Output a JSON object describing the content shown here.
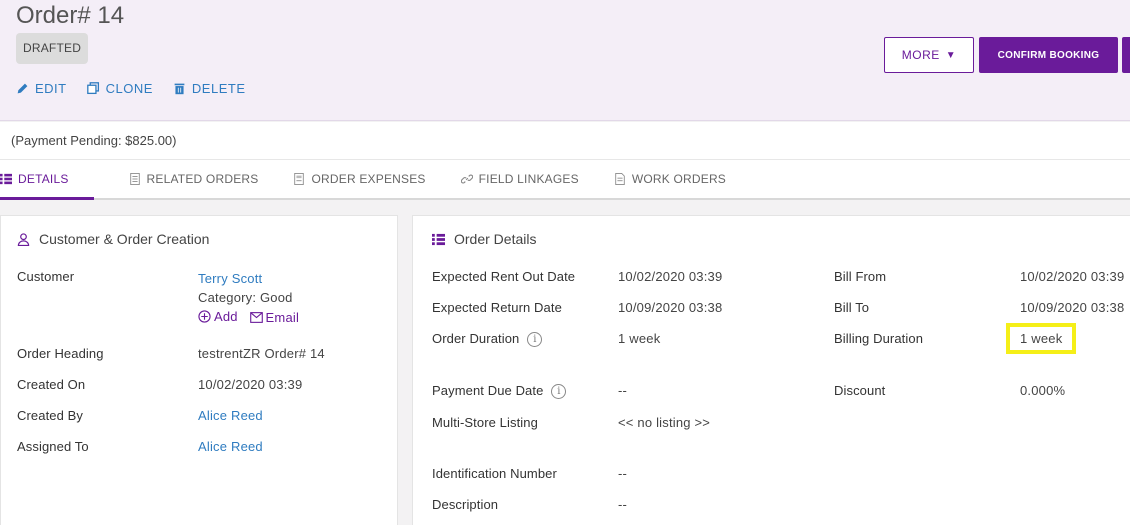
{
  "header": {
    "title": "Order# 14",
    "status": "DRAFTED",
    "actions": {
      "edit": "EDIT",
      "clone": "CLONE",
      "delete": "DELETE"
    },
    "more_label": "MORE",
    "confirm_label": "CONFIRM BOOKING"
  },
  "payment_pending": "(Payment Pending: $825.00)",
  "tabs": [
    {
      "label": "DETAILS",
      "icon": "list-icon"
    },
    {
      "label": "RELATED ORDERS",
      "icon": "document-icon"
    },
    {
      "label": "ORDER EXPENSES",
      "icon": "expense-icon"
    },
    {
      "label": "FIELD LINKAGES",
      "icon": "link-icon"
    },
    {
      "label": "WORK ORDERS",
      "icon": "work-order-icon"
    }
  ],
  "customer_card": {
    "title": "Customer & Order Creation",
    "customer_label": "Customer",
    "customer_name": "Terry Scott",
    "category": "Category: Good",
    "add_label": "Add",
    "email_label": "Email",
    "order_heading_label": "Order Heading",
    "order_heading": "testrentZR Order# 14",
    "created_on_label": "Created On",
    "created_on": "10/02/2020 03:39",
    "created_by_label": "Created By",
    "created_by": "Alice Reed",
    "assigned_to_label": "Assigned To",
    "assigned_to": "Alice Reed"
  },
  "order_card": {
    "title": "Order Details",
    "rent_out_label": "Expected Rent Out Date",
    "rent_out": "10/02/2020 03:39",
    "return_label": "Expected Return Date",
    "return": "10/09/2020 03:38",
    "duration_label": "Order Duration",
    "duration": "1 week",
    "payment_due_label": "Payment Due Date",
    "payment_due": "--",
    "multistore_label": "Multi-Store Listing",
    "multistore": "<< no listing >>",
    "identification_label": "Identification Number",
    "identification": "--",
    "description_label": "Description",
    "description": "--",
    "bill_from_label": "Bill From",
    "bill_from": "10/02/2020 03:39",
    "bill_to_label": "Bill To",
    "bill_to": "10/09/2020 03:38",
    "billing_duration_label": "Billing Duration",
    "billing_duration": "1 week",
    "discount_label": "Discount",
    "discount": "0.000%"
  },
  "colors": {
    "accent": "#6a1b9a",
    "link": "#2f7cc0",
    "highlight": "#f5ef18"
  }
}
